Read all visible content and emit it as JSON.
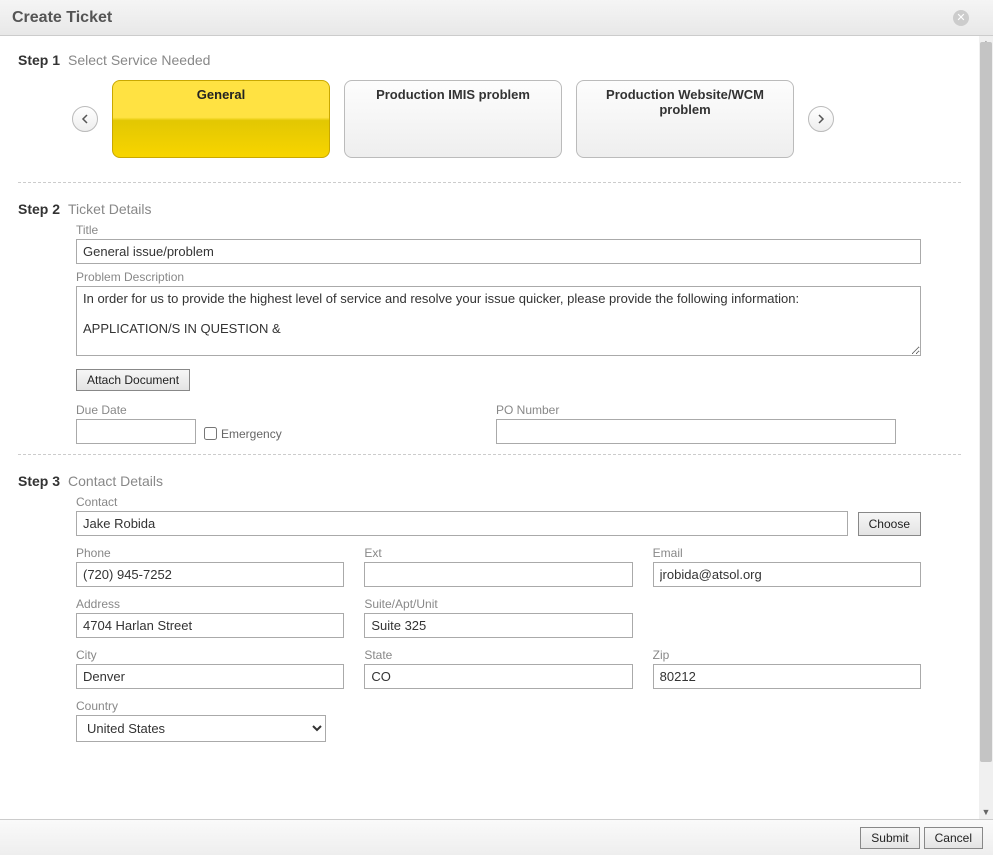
{
  "header": {
    "title": "Create Ticket"
  },
  "step1": {
    "label": "Step 1",
    "title": "Select Service Needed",
    "services": [
      {
        "label": "General",
        "selected": true
      },
      {
        "label": "Production IMIS problem",
        "selected": false
      },
      {
        "label": "Production Website/WCM problem",
        "selected": false
      }
    ]
  },
  "step2": {
    "label": "Step 2",
    "title": "Ticket Details",
    "title_field_label": "Title",
    "title_field_value": "General issue/problem",
    "desc_label": "Problem Description",
    "desc_value": "In order for us to provide the highest level of service and resolve your issue quicker, please provide the following information:\n\nAPPLICATION/S IN QUESTION &",
    "attach_label": "Attach Document",
    "due_date_label": "Due Date",
    "due_date_value": "",
    "emergency_label": "Emergency",
    "po_label": "PO Number",
    "po_value": ""
  },
  "step3": {
    "label": "Step 3",
    "title": "Contact Details",
    "contact_label": "Contact",
    "contact_value": "Jake Robida",
    "choose_label": "Choose",
    "phone_label": "Phone",
    "phone_value": "(720) 945-7252",
    "ext_label": "Ext",
    "ext_value": "",
    "email_label": "Email",
    "email_value": "jrobida@atsol.org",
    "address_label": "Address",
    "address_value": "4704 Harlan Street",
    "suite_label": "Suite/Apt/Unit",
    "suite_value": "Suite 325",
    "city_label": "City",
    "city_value": "Denver",
    "state_label": "State",
    "state_value": "CO",
    "zip_label": "Zip",
    "zip_value": "80212",
    "country_label": "Country",
    "country_value": "United States"
  },
  "footer": {
    "submit": "Submit",
    "cancel": "Cancel"
  }
}
